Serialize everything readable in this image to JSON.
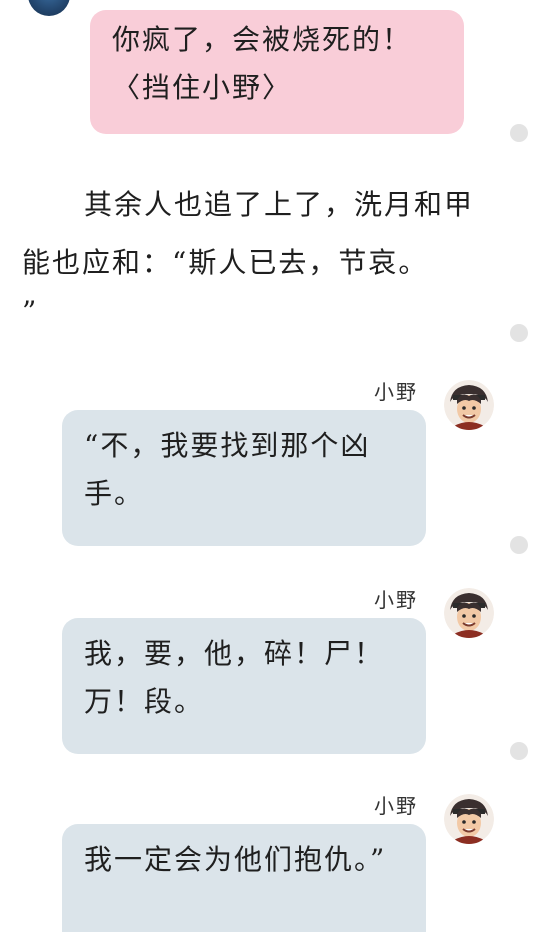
{
  "top_message": {
    "text": "你疯了，会被烧死的！〈挡住小野〉"
  },
  "narration": {
    "main": "其余人也追了上了，洗月和甲能也应和：“斯人已去，节哀。",
    "tail": "”"
  },
  "messages": [
    {
      "speaker": "小野",
      "text": "“不，我要找到那个凶手。"
    },
    {
      "speaker": "小野",
      "text": "我，要，他，碎！尸！万！段。"
    },
    {
      "speaker": "小野",
      "text": "我一定会为他们抱仇。”"
    }
  ],
  "icons": {
    "speaker_avatar": "character-avatar-icon",
    "top_avatar": "character-avatar-icon",
    "side_marker": "circle-marker-icon"
  },
  "colors": {
    "pink_bubble": "#f9cdd8",
    "blue_bubble": "#dbe4ea",
    "marker": "#e3e3e3"
  }
}
